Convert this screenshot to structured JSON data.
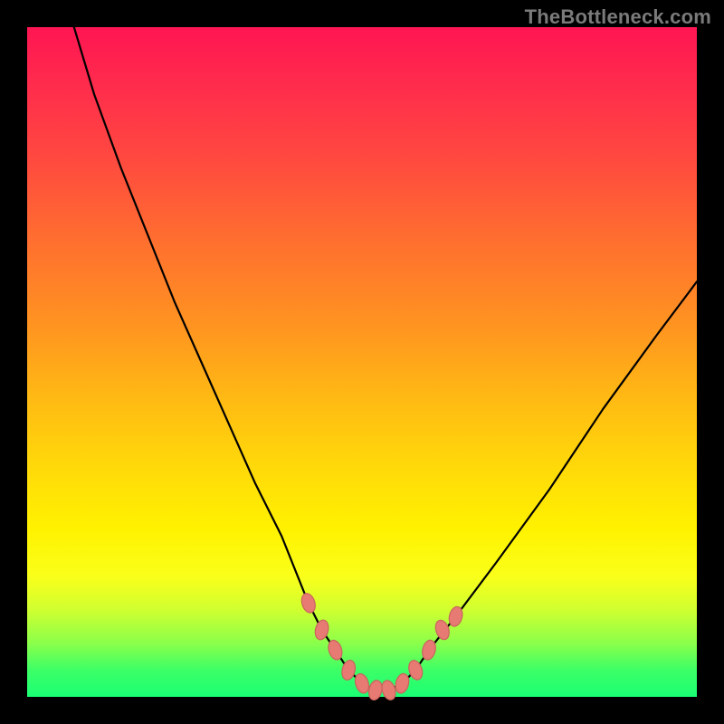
{
  "watermark": "TheBottleneck.com",
  "colors": {
    "frame_bg": "#000000",
    "gradient_top": "#ff1552",
    "gradient_mid": "#ffd70a",
    "gradient_bottom": "#1aff74",
    "curve": "#000000",
    "marker_fill": "#e77a72",
    "marker_stroke": "#c9645d"
  },
  "chart_data": {
    "type": "line",
    "title": "",
    "xlabel": "",
    "ylabel": "",
    "x_range": [
      0,
      100
    ],
    "y_range": [
      0,
      100
    ],
    "note": "Axes unlabeled; V-shaped bottleneck curve with left branch steeper than right. y≈0 is bottom (green), y≈100 is top (red). Values estimated from pixel positions.",
    "series": [
      {
        "name": "bottleneck-curve",
        "x": [
          7,
          10,
          14,
          18,
          22,
          26,
          30,
          34,
          38,
          42,
          44,
          46,
          48,
          50,
          52,
          54,
          56,
          58,
          60,
          64,
          70,
          78,
          86,
          94,
          100
        ],
        "y": [
          100,
          90,
          79,
          69,
          59,
          50,
          41,
          32,
          24,
          14,
          10,
          7,
          4,
          2,
          1,
          1,
          2,
          4,
          7,
          12,
          20,
          31,
          43,
          54,
          62
        ]
      }
    ],
    "markers": [
      {
        "x": 42,
        "y": 14
      },
      {
        "x": 44,
        "y": 10
      },
      {
        "x": 46,
        "y": 7
      },
      {
        "x": 48,
        "y": 4
      },
      {
        "x": 50,
        "y": 2
      },
      {
        "x": 52,
        "y": 1
      },
      {
        "x": 54,
        "y": 1
      },
      {
        "x": 56,
        "y": 2
      },
      {
        "x": 58,
        "y": 4
      },
      {
        "x": 60,
        "y": 7
      },
      {
        "x": 62,
        "y": 10
      },
      {
        "x": 64,
        "y": 12
      }
    ]
  }
}
